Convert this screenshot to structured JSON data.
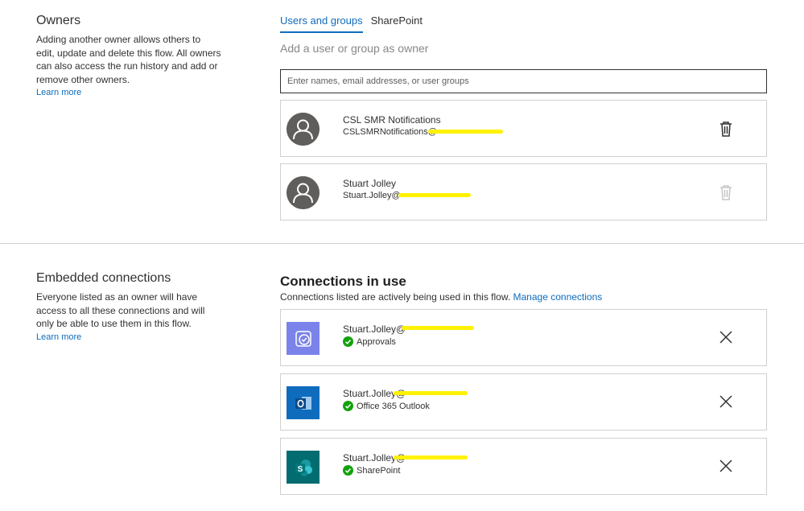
{
  "owners": {
    "title": "Owners",
    "description": "Adding another owner allows others to edit, update and delete this flow. All owners can also access the run history and add or remove other owners.",
    "learn_more": "Learn more",
    "tabs": [
      {
        "label": "Users and groups",
        "active": true
      },
      {
        "label": "SharePoint",
        "active": false
      }
    ],
    "add_label": "Add a user or group as owner",
    "search_placeholder": "Enter names, email addresses, or user groups",
    "list": [
      {
        "name": "CSL SMR Notifications",
        "email": "CSLSMRNotifications@",
        "delete_enabled": true,
        "icon": "trash-icon"
      },
      {
        "name": "Stuart Jolley",
        "email": "Stuart.Jolley@",
        "delete_enabled": false,
        "icon": "trash-icon"
      }
    ]
  },
  "embedded": {
    "title": "Embedded connections",
    "description": "Everyone listed as an owner will have access to all these connections and will only be able to use them in this flow.",
    "learn_more": "Learn more"
  },
  "connections": {
    "heading": "Connections in use",
    "subtext": "Connections listed are actively being used in this flow.",
    "manage_link": "Manage connections",
    "list": [
      {
        "account": "Stuart.Jolley@",
        "service": "Approvals",
        "icon": "approvals-icon",
        "icon_color": "#7b83eb",
        "status": "connected"
      },
      {
        "account": "Stuart.Jolley@",
        "service": "Office 365 Outlook",
        "icon": "outlook-icon",
        "icon_color": "#0f6cbd",
        "status": "connected"
      },
      {
        "account": "Stuart.Jolley@",
        "service": "SharePoint",
        "icon": "sharepoint-icon",
        "icon_color": "#036c70",
        "status": "connected"
      }
    ]
  },
  "colors": {
    "accent": "#0f6cbd",
    "success": "#13a10e",
    "redaction": "#fff200"
  }
}
